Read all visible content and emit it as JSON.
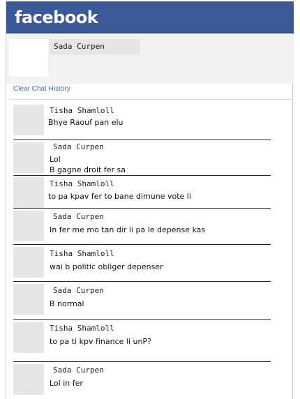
{
  "app": {
    "logo": "facebook"
  },
  "profile": {
    "name": "Sada Curpen"
  },
  "chat": {
    "clear_label": "Clear Chat History",
    "messages": [
      {
        "sender": "Tisha Shamloll",
        "lines": [
          "Bhye Raouf pan elu"
        ]
      },
      {
        "sender": "Sada Curpen",
        "lines": [
          "Lol",
          "B gagne droit fer sa"
        ]
      },
      {
        "sender": "Tisha Shamloll",
        "lines": [
          "to pa kpav fer to bane dimune vote li"
        ]
      },
      {
        "sender": "Sada Curpen",
        "lines": [
          "In fer me mo tan dir li pa le depense kas"
        ]
      },
      {
        "sender": "Tisha Shamloll",
        "lines": [
          "wai b politic obliger depenser"
        ]
      },
      {
        "sender": "Sada Curpen",
        "lines": [
          "B normal"
        ]
      },
      {
        "sender": "Tisha Shamloll",
        "lines": [
          "to pa ti kpv finance li unP?"
        ]
      },
      {
        "sender": "Sada Curpen",
        "lines": [
          "Lol in fer"
        ]
      }
    ]
  },
  "colors": {
    "header_blue": "#3b5998",
    "link_blue": "#4a6aa5"
  }
}
